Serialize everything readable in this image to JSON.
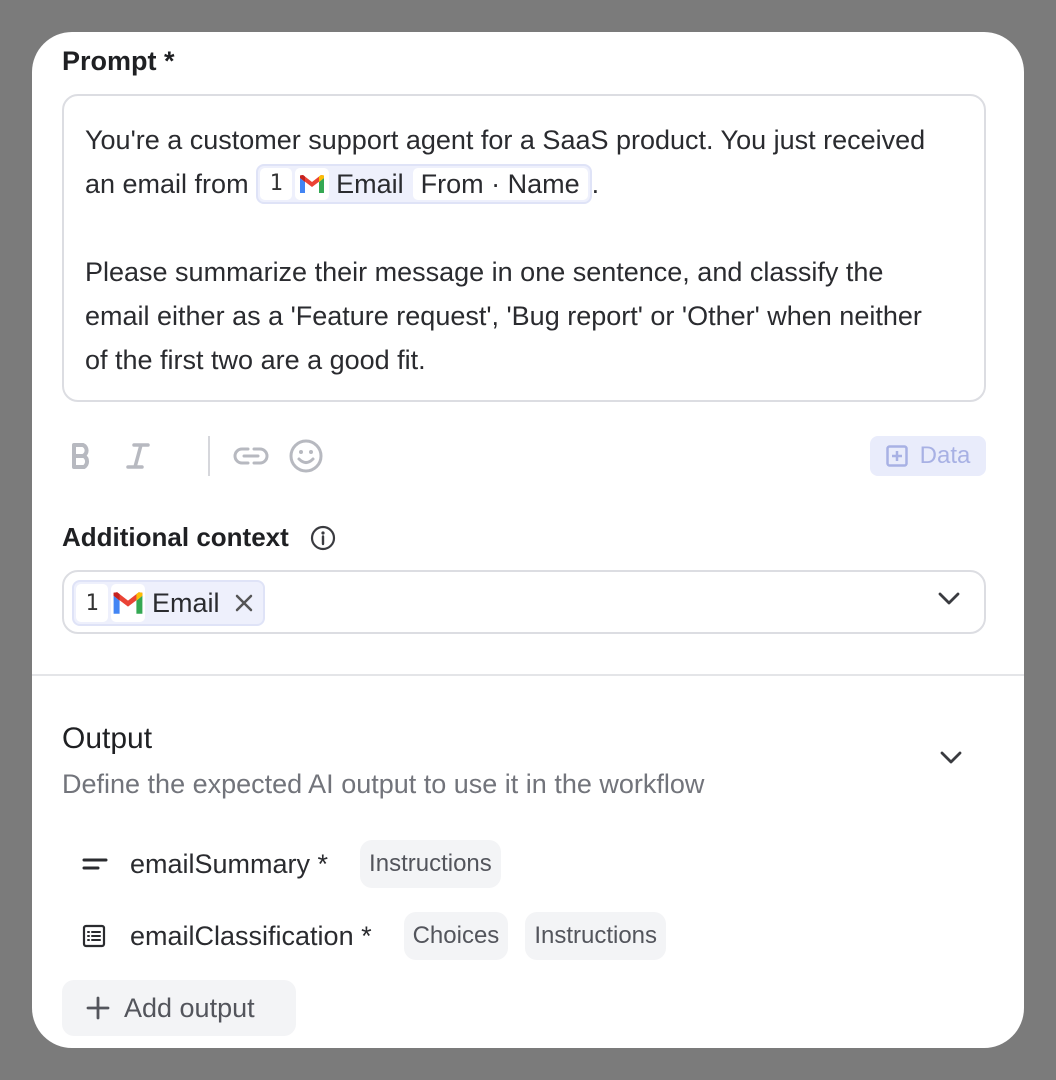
{
  "prompt": {
    "label": "Prompt *",
    "line1": "You're a customer support agent for a SaaS product. You just received",
    "line2_before": "an email from",
    "token": {
      "step": "1",
      "app": "Email",
      "field": "From · Name"
    },
    "line2_after": ".",
    "line3": "Please summarize their message in one sentence, and classify the",
    "line4": "email either as a 'Feature request', 'Bug report' or 'Other' when neither",
    "line5": "of the first two are a good fit."
  },
  "toolbar": {
    "bold_icon": "bold-icon",
    "italic_icon": "italic-icon",
    "link_icon": "link-icon",
    "emoji_icon": "emoji-icon",
    "data_label": "Data"
  },
  "additional_context": {
    "label": "Additional context",
    "token": {
      "step": "1",
      "app": "Email"
    }
  },
  "output": {
    "title": "Output",
    "subtitle": "Define the expected AI output to use it in the workflow",
    "items": [
      {
        "name": "emailSummary *",
        "icon": "text-lines-icon",
        "chips": [
          "Instructions"
        ]
      },
      {
        "name": "emailClassification *",
        "icon": "list-icon",
        "chips": [
          "Choices",
          "Instructions"
        ]
      }
    ],
    "add_label": "Add output"
  },
  "colors": {
    "accent_bg": "#eef0fc",
    "accent_text": "#a8b1e4",
    "backdrop": "#7b7b7b"
  }
}
